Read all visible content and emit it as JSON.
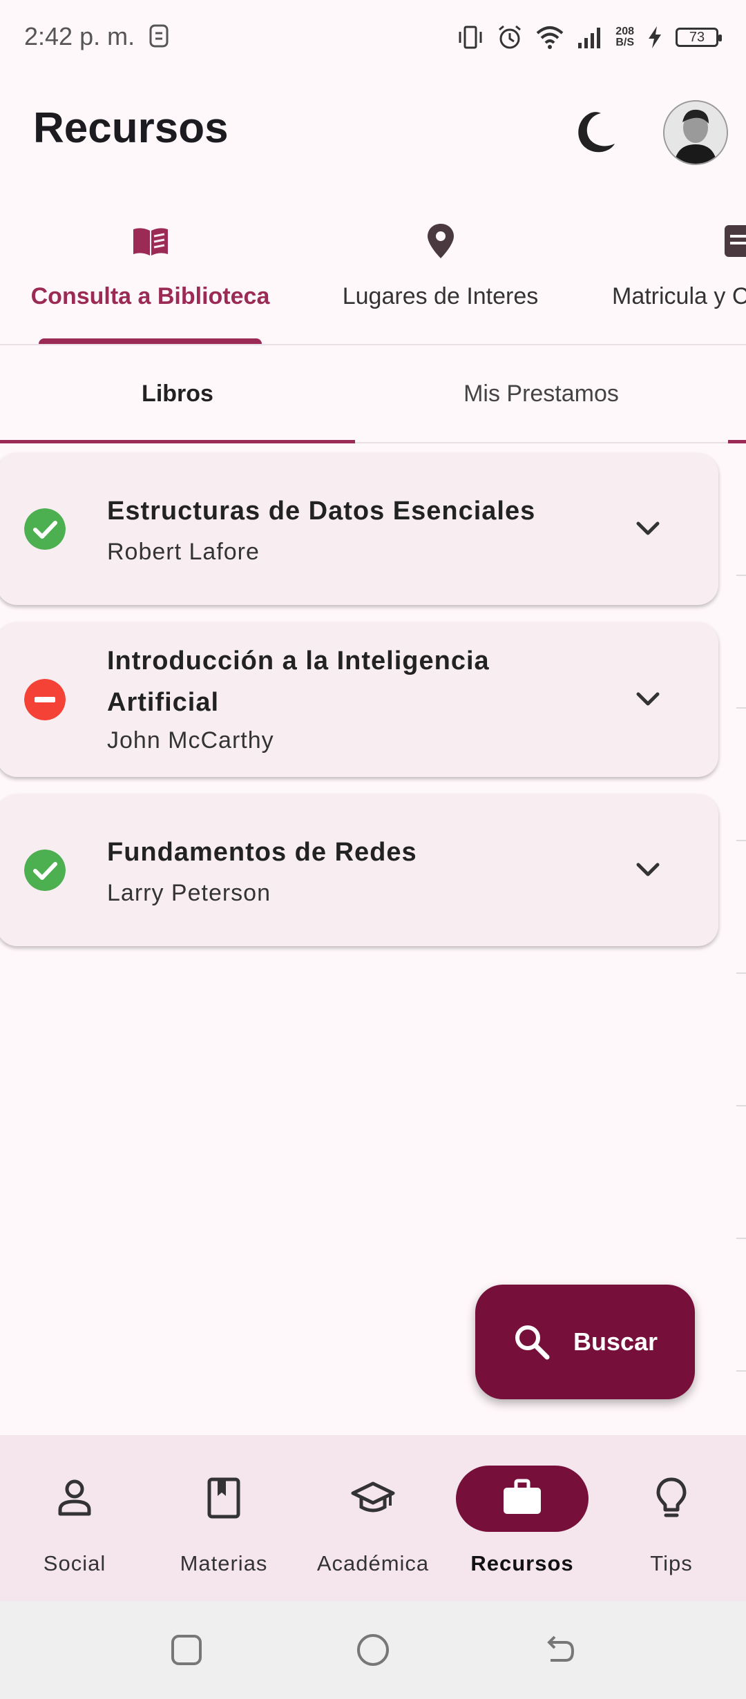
{
  "status_bar": {
    "time": "2:42 p. m.",
    "speed_value": "208",
    "speed_unit": "B/S",
    "battery": "73"
  },
  "header": {
    "title": "Recursos"
  },
  "top_tabs": [
    {
      "label": "Consulta a Biblioteca",
      "icon": "book-open-icon",
      "active": true
    },
    {
      "label": "Lugares de Interes",
      "icon": "location-pin-icon",
      "active": false
    },
    {
      "label": "Matricula y C",
      "icon": "document-icon",
      "active": false
    }
  ],
  "sub_tabs": [
    {
      "label": "Libros",
      "active": true
    },
    {
      "label": "Mis Prestamos",
      "active": false
    }
  ],
  "books": [
    {
      "title": "Estructuras de Datos Esenciales",
      "author": "Robert Lafore",
      "status": "available",
      "status_icon": "check-circle-icon",
      "status_color": "#4caf50"
    },
    {
      "title": "Introducción a la Inteligencia Artificial",
      "author": "John McCarthy",
      "status": "unavailable",
      "status_icon": "minus-circle-icon",
      "status_color": "#f44336"
    },
    {
      "title": "Fundamentos de Redes",
      "author": "Larry Peterson",
      "status": "available",
      "status_icon": "check-circle-icon",
      "status_color": "#4caf50"
    }
  ],
  "fab": {
    "label": "Buscar",
    "icon": "search-icon"
  },
  "bottom_nav": [
    {
      "label": "Social",
      "icon": "person-icon",
      "active": false
    },
    {
      "label": "Materias",
      "icon": "bookmark-book-icon",
      "active": false
    },
    {
      "label": "Académica",
      "icon": "graduation-cap-icon",
      "active": false
    },
    {
      "label": "Recursos",
      "icon": "briefcase-icon",
      "active": true
    },
    {
      "label": "Tips",
      "icon": "lightbulb-icon",
      "active": false
    }
  ],
  "colors": {
    "accent": "#9b2a55",
    "primary_dark": "#76103a",
    "background": "#fff8fb",
    "card": "#f8eef2",
    "nav_background": "#f5e6ee"
  }
}
